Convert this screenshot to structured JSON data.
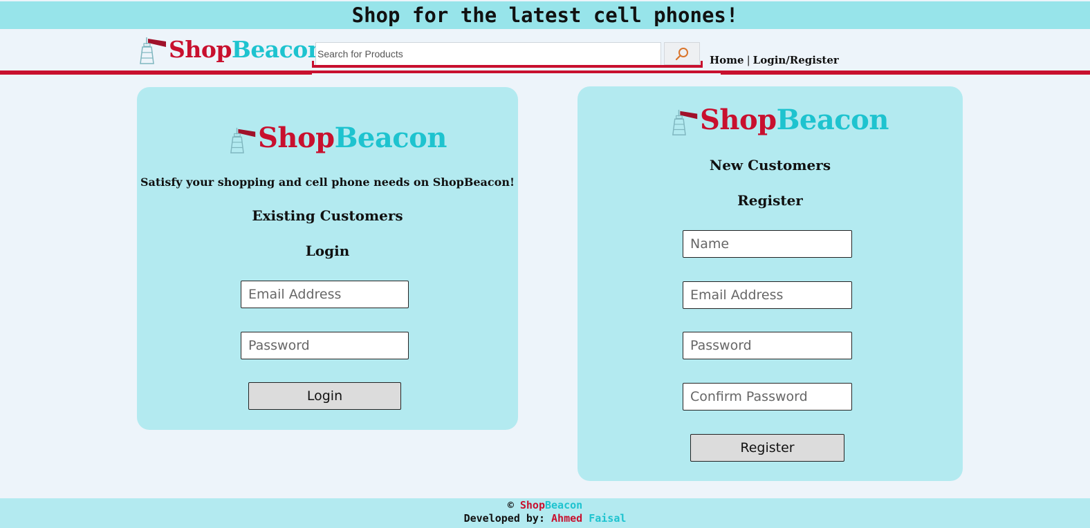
{
  "banner": {
    "text": "Shop for the latest cell phones!"
  },
  "brand": {
    "part1": "Shop",
    "part2": "Beacon"
  },
  "search": {
    "placeholder": "Search for Products"
  },
  "nav": {
    "home": "Home",
    "separator": "|",
    "login_register": "Login/Register"
  },
  "login": {
    "tagline": "Satisfy your shopping and cell phone needs on ShopBeacon!",
    "heading": "Existing Customers",
    "subheading": "Login",
    "email_placeholder": "Email Address",
    "password_placeholder": "Password",
    "button": "Login"
  },
  "register": {
    "heading": "New Customers",
    "subheading": "Register",
    "name_placeholder": "Name",
    "email_placeholder": "Email Address",
    "password_placeholder": "Password",
    "confirm_placeholder": "Confirm Password",
    "button": "Register"
  },
  "footer": {
    "copyright": "©",
    "developed_by": "Developed by:",
    "dev_first": "Ahmed",
    "dev_last": "Faisal"
  },
  "colors": {
    "brand_red": "#c8102e",
    "brand_teal": "#1ec3cf",
    "banner_bg": "#97e4ea",
    "card_bg": "#b3eaf0"
  },
  "icons": {
    "search": "magnifier-icon",
    "logo": "lighthouse-icon"
  }
}
